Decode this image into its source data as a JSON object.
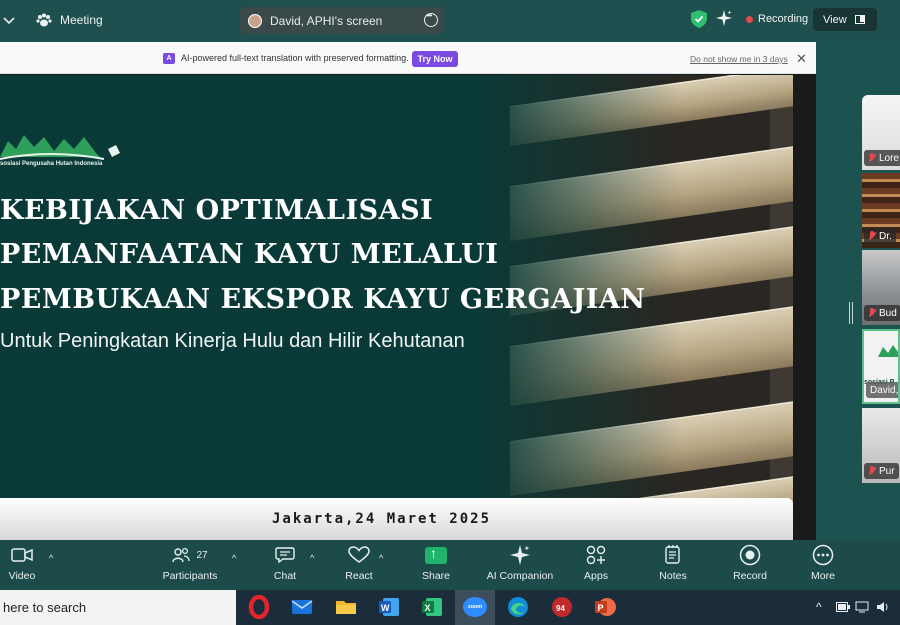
{
  "topbar": {
    "meeting_label": "Meeting",
    "screen_label": "David, APHI's screen",
    "recording_label": "Recording",
    "view_label": "View",
    "colors": {
      "recording_dot": "#e5484d",
      "shield": "#2fbf71"
    }
  },
  "banner": {
    "text": "AI-powered full-text translation with preserved formatting.",
    "try_label": "Try Now",
    "dismiss_label": "Do not show me in 3 days",
    "accent": "#7b4ae2"
  },
  "slide": {
    "logo_text": "sosiasi Pengusaha Hutan Indonesia",
    "title_lines": [
      "KEBIJAKAN OPTIMALISASI",
      "PEMANFAATAN KAYU MELALUI",
      "PEMBUKAAN EKSPOR KAYU GERGAJIAN"
    ],
    "subtitle": "Untuk Peningkatan Kinerja Hulu dan Hilir Kehutanan",
    "date": "Jakarta,24 Maret 2025"
  },
  "participants": [
    {
      "name": "Lore"
    },
    {
      "name": "Dr."
    },
    {
      "name": "Bud"
    },
    {
      "name": "David,",
      "logo_text": "sosiasi P"
    },
    {
      "name": "Pur"
    }
  ],
  "controls": {
    "video": "Video",
    "participants": "Participants",
    "participant_count": "27",
    "chat": "Chat",
    "react": "React",
    "share": "Share",
    "ai_companion": "AI Companion",
    "apps": "Apps",
    "notes": "Notes",
    "record": "Record",
    "more": "More"
  },
  "taskbar": {
    "search_placeholder": "here to search",
    "zoom_label": "zoom",
    "badge": "94"
  }
}
